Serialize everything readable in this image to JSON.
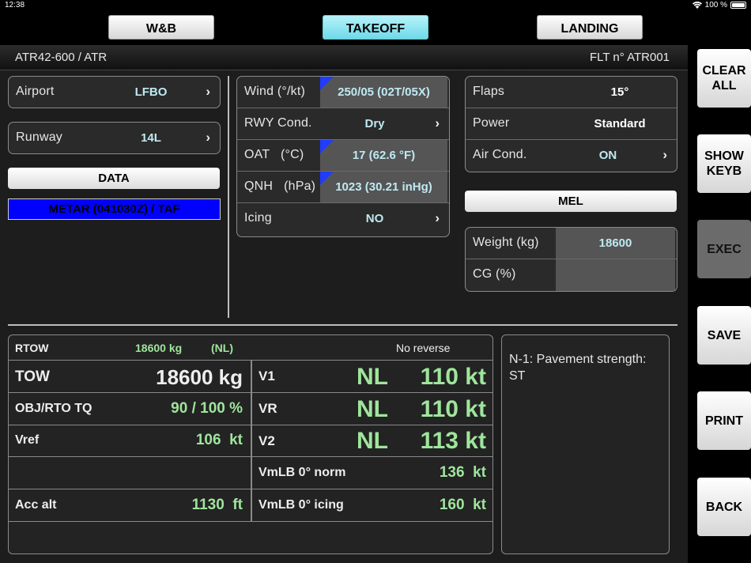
{
  "status": {
    "time": "12:38",
    "battery": "100 %"
  },
  "tabs": [
    {
      "label": "W&B",
      "active": false
    },
    {
      "label": "TAKEOFF",
      "active": true
    },
    {
      "label": "LANDING",
      "active": false
    }
  ],
  "header": {
    "aircraft": "ATR42-600 / ATR",
    "flight": "FLT n° ATR001"
  },
  "airport": {
    "label": "Airport",
    "value": "LFBO"
  },
  "runway": {
    "label": "Runway",
    "value": "14L"
  },
  "data_button": "DATA",
  "metar_button": "METAR (041030Z) / TAF",
  "conditions": {
    "wind": {
      "label": "Wind  (°/kt)",
      "value": "250/05 (02T/05X)"
    },
    "rwy_cond": {
      "label": "RWY Cond.",
      "value": "Dry"
    },
    "oat": {
      "label": "OAT   (°C)",
      "value": "17 (62.6 °F)"
    },
    "qnh": {
      "label": "QNH   (hPa)",
      "value": "1023 (30.21 inHg)"
    },
    "icing": {
      "label": "Icing",
      "value": "NO"
    }
  },
  "config": {
    "flaps": {
      "label": "Flaps",
      "value": "15°"
    },
    "power": {
      "label": "Power",
      "value": "Standard"
    },
    "air_cond": {
      "label": "Air Cond.",
      "value": "ON"
    }
  },
  "mel_button": "MEL",
  "weight": {
    "label": "Weight (kg)",
    "value": "18600"
  },
  "cg": {
    "label": "CG (%)",
    "value": ""
  },
  "results": {
    "rtow_label": "RTOW",
    "rtow_value": "18600 kg",
    "rtow_limit": "(NL)",
    "reverse": "No reverse",
    "tow_label": "TOW",
    "tow_value": "18600 kg",
    "tq_label": "OBJ/RTO TQ",
    "tq_value": "90 / 100 %",
    "vref_label": "Vref",
    "vref_value": "106  kt",
    "acc_label": "Acc alt",
    "acc_value": "1130  ft",
    "v1_label": "V1",
    "v1_nl": "NL",
    "v1_value": "110 kt",
    "vr_label": "VR",
    "vr_nl": "NL",
    "vr_value": "110 kt",
    "v2_label": "V2",
    "v2_nl": "NL",
    "v2_value": "113 kt",
    "vmlb_norm_label": "VmLB 0° norm",
    "vmlb_norm_value": "136  kt",
    "vmlb_icing_label": "VmLB 0° icing",
    "vmlb_icing_value": "160  kt"
  },
  "note": "N-1: Pavement strength: ST",
  "actions": {
    "clear_all": "CLEAR ALL",
    "show_keyb": "SHOW KEYB",
    "exec": "EXEC",
    "save": "SAVE",
    "print": "PRINT",
    "back": "BACK"
  },
  "colors": {
    "tab_active": "#6fd9e8",
    "value_text": "#bfe9f2",
    "result_green": "#9fe59c",
    "metar_blue": "#0000ff"
  }
}
